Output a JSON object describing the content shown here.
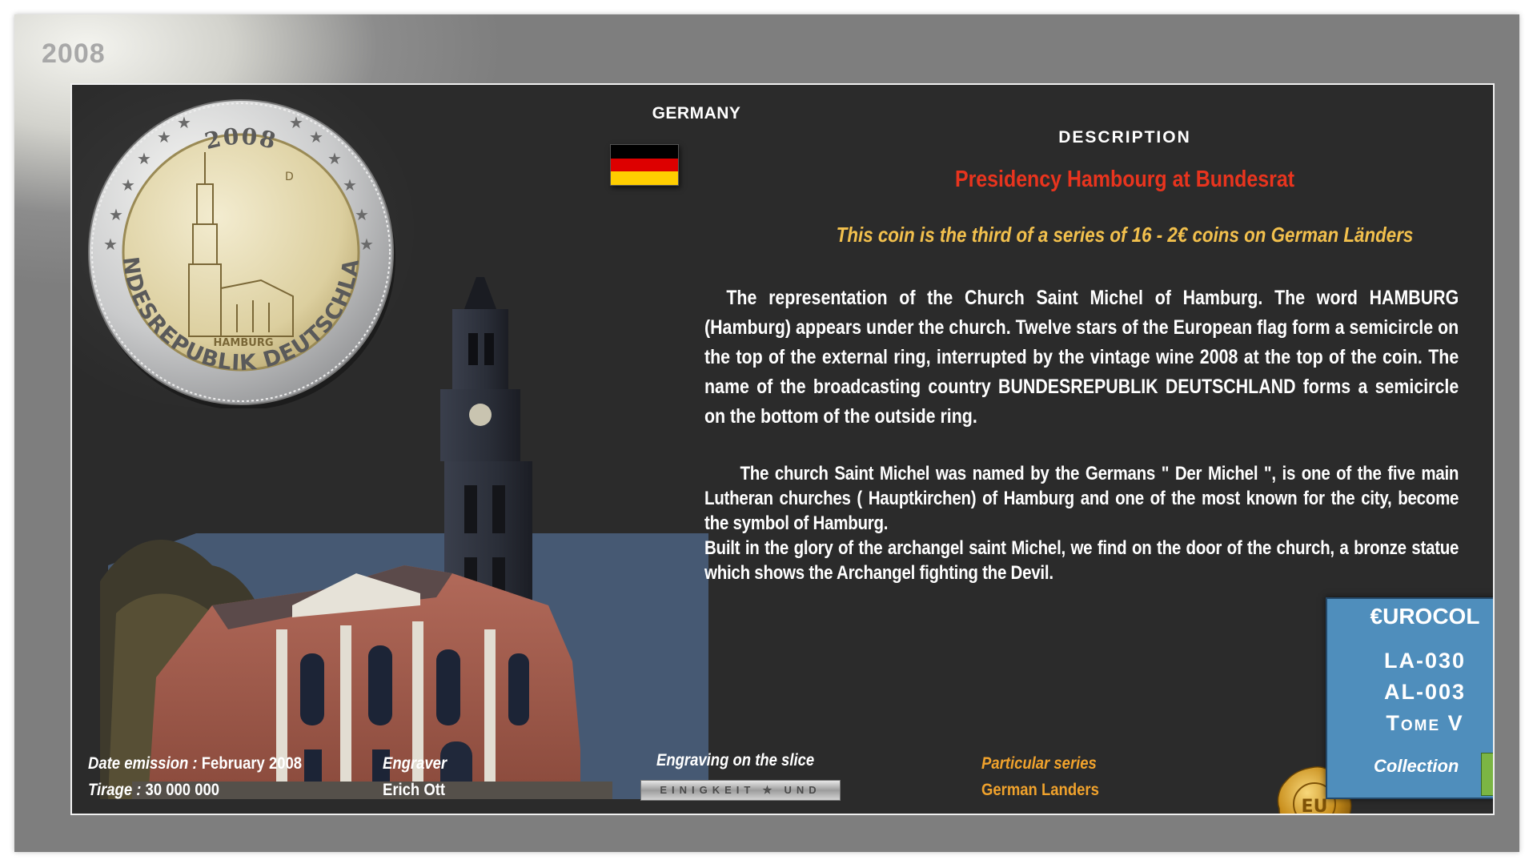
{
  "year": "2008",
  "coin": {
    "year": "2008",
    "mint_mark": "D",
    "city": "HAMBURG",
    "ring_text": "BUNDESREPUBLIK DEUTSCHLAND"
  },
  "country": "GERMANY",
  "description": {
    "heading": "DESCRIPTION",
    "title": "Presidency Hambourg at Bundesrat",
    "subtitle": "This coin is the third of a series of 16 - 2€ coins on German Länders",
    "paragraph1": "The representation of the Church Saint Michel of Hamburg. The word HAMBURG (Hamburg) appears under the church. Twelve stars of the European flag form a semicircle on the top of the external ring, interrupted by the vintage wine 2008 at the top of the coin. The name of the broadcasting country BUNDESREPUBLIK DEUTSCHLAND forms a semicircle on the bottom of the outside ring.",
    "paragraph2": "The church Saint Michel was named by the Germans \" Der Michel \", is one of the five main Lutheran churches ( Hauptkirchen) of Hamburg and one of the most known for the city, become the symbol of Hamburg.",
    "paragraph3": "Built in the glory of the archangel saint Michel, we find on the door of the church, a bronze statue which shows the Archangel fighting the Devil."
  },
  "footer": {
    "date_label": "Date emission :",
    "date_value": "February  2008",
    "tirage_label": "Tirage :",
    "tirage_value": "30 000 000",
    "engraver_label": "Engraver",
    "engraver_value": "Erich Ott",
    "slice_label": "Engraving on the slice",
    "slice_text": "EINIGKEIT ✯ UND",
    "series_label": "Particular series",
    "series_value": "German Landers"
  },
  "eurocol": {
    "title": "€UROCOL",
    "ref1": "LA-030",
    "ref2": "AL-003",
    "ref3": "Tome V",
    "collection_label": "Collection"
  },
  "seal_text": "EU",
  "colors": {
    "panel": "#2b2b2b",
    "title_red": "#e8341e",
    "subtitle_gold": "#f2c04d",
    "series_orange": "#f0a22c",
    "eurocol_blue": "#4f8ebc",
    "collection_green": "#7bb544",
    "flag": [
      "#000000",
      "#dd0000",
      "#ffce00"
    ]
  }
}
